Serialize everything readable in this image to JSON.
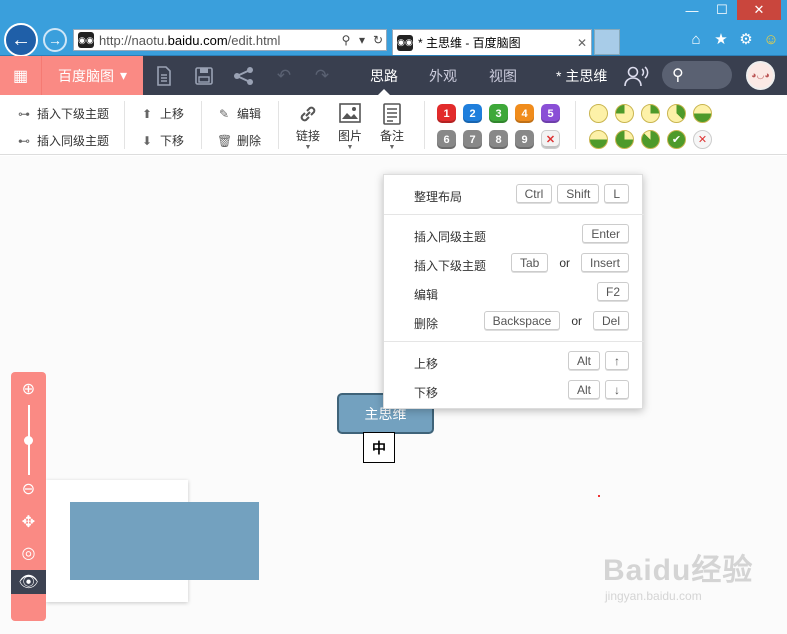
{
  "browser": {
    "url_prefix": "http://naotu.",
    "url_domain": "baidu.com",
    "url_suffix": "/edit.html",
    "tab_title": "* 主思维 - 百度脑图",
    "favicon": "owl-icon"
  },
  "topbar": {
    "app_name": "百度脑图",
    "tabs": [
      "思路",
      "外观",
      "视图"
    ],
    "active_tab": "思路",
    "doc_title": "* 主思维",
    "accent_color": "#fa8a84",
    "bar_color": "#393f4f"
  },
  "ribbon": {
    "insert_child": "插入下级主题",
    "insert_sibling": "插入同级主题",
    "move_up": "上移",
    "move_down": "下移",
    "edit": "编辑",
    "delete": "删除",
    "link": "链接",
    "image": "图片",
    "note": "备注",
    "priorities": [
      "1",
      "2",
      "3",
      "4",
      "5",
      "6",
      "7",
      "8",
      "9"
    ],
    "priority_colors": [
      "#e22b2b",
      "#1f7fdc",
      "#3ea839",
      "#f08c1c",
      "#8a4fd6",
      "#888888",
      "#888888",
      "#888888",
      "#888888"
    ]
  },
  "menu": {
    "arrange": "整理布局",
    "arrange_keys": [
      "Ctrl",
      "Shift",
      "L"
    ],
    "insert_sibling": "插入同级主题",
    "insert_sibling_keys": [
      "Enter"
    ],
    "insert_child": "插入下级主题",
    "insert_child_keys": [
      "Tab",
      "Insert"
    ],
    "edit": "编辑",
    "edit_keys": [
      "F2"
    ],
    "delete": "删除",
    "delete_keys": [
      "Backspace",
      "Del"
    ],
    "move_up": "上移",
    "move_up_keys": [
      "Alt",
      "↑"
    ],
    "move_down": "下移",
    "move_down_keys": [
      "Alt",
      "↓"
    ],
    "or": "or"
  },
  "canvas": {
    "root_node": "主思维",
    "ime_char": "中"
  },
  "zoom": {
    "level": 0.5
  },
  "watermark": {
    "logo": "Baidu经验",
    "site": "jingyan.baidu.com"
  }
}
